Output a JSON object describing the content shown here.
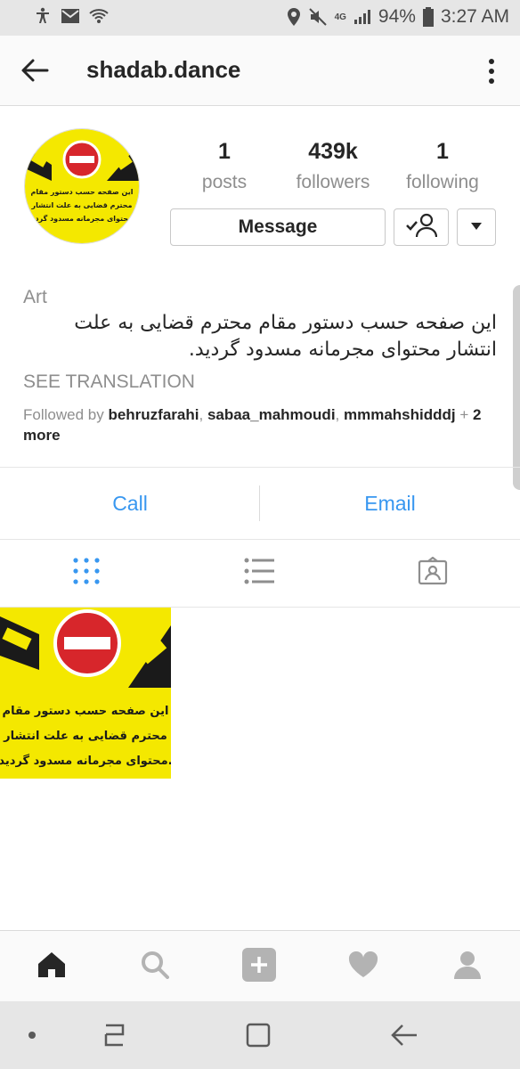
{
  "status_bar": {
    "battery": "94%",
    "time": "3:27 AM",
    "network": "4G"
  },
  "header": {
    "title": "shadab.dance"
  },
  "profile": {
    "avatar_text": [
      "این صفحه حسب دستور مقام",
      "محترم قضایی به علت انتشار",
      "محتوای مجرمانه مسدود گردید."
    ],
    "stats": {
      "posts": {
        "value": "1",
        "label": "posts"
      },
      "followers": {
        "value": "439k",
        "label": "followers"
      },
      "following": {
        "value": "1",
        "label": "following"
      }
    },
    "message_label": "Message",
    "category": "Art",
    "bio": "این صفحه حسب دستور مقام محترم قضایی به علت انتشار محتوای مجرمانه مسدود گردید.",
    "see_translation": "SEE TRANSLATION",
    "followed_by_prefix": "Followed by",
    "followed_by_users": [
      "behruzfarahi",
      "sabaa_mahmoudi",
      "mmmahshidddj"
    ],
    "followed_by_more": "+ 2 more"
  },
  "contact": {
    "call": "Call",
    "email": "Email"
  },
  "tabs": [
    {
      "name": "grid-icon",
      "active": true
    },
    {
      "name": "list-icon",
      "active": false
    },
    {
      "name": "tagged-icon",
      "active": false
    }
  ],
  "post": {
    "text": [
      "این صفحه حسب دستور مقام",
      "محترم قضایی به علت انتشار",
      "محتوای مجرمانه مسدود گردید."
    ]
  },
  "bottom_nav": [
    "home-icon",
    "search-icon",
    "add-icon",
    "heart-icon",
    "profile-icon"
  ],
  "colors": {
    "accent": "#3897f0",
    "sign_yellow": "#f4e800",
    "sign_red": "#d7262b"
  }
}
